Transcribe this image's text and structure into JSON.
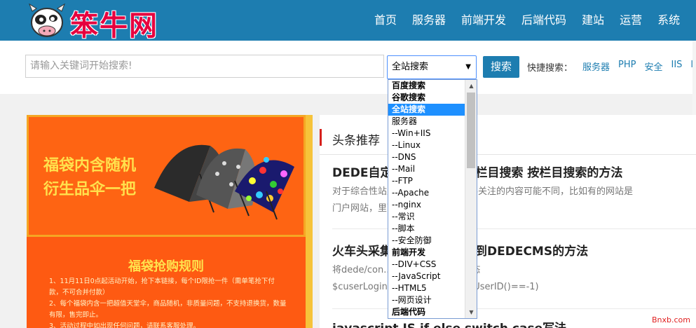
{
  "header": {
    "logo_text": "笨牛网",
    "nav": [
      "首页",
      "服务器",
      "前端开发",
      "后端代码",
      "建站",
      "运营",
      "系统"
    ]
  },
  "search": {
    "placeholder": "请输入关键词开始搜索!",
    "select_value": "全站搜索",
    "button_label": "搜索",
    "quick_label": "快捷搜索：",
    "quick_links": [
      "服务器",
      "PHP",
      "安全",
      "IIS",
      "li"
    ]
  },
  "dropdown": {
    "options": [
      "百度搜索",
      "谷歌搜索",
      "全站搜索",
      "服务器",
      "--Win+IIS",
      "--Linux",
      "--DNS",
      "--Mail",
      "--FTP",
      "--Apache",
      "--nginx",
      "--常识",
      "--脚本",
      "--安全防御",
      "前端开发",
      "--DIV+CSS",
      "--JavaScript",
      "--HTML5",
      "--网页设计",
      "后端代码"
    ],
    "selected_index": 2
  },
  "ad": {
    "headline_line1": "福袋内含随机",
    "headline_line2": "衍生品伞一把",
    "rules_title": "福袋抢购规则",
    "rules": [
      "1、11月11日0点起活动开始，抢下本链接，每个ID限抢一件（需单笔抢下付款，不可合并付款）",
      "2、每个福袋内含一把超值天堂伞，商品随机，非质量问题，不支持退换货，数量有限，售完即止。",
      "3、活动过程中如出现任何问题，请联系客服处理。"
    ]
  },
  "content": {
    "section_title": "头条推荐",
    "articles": [
      {
        "title": "DEDE自定义搜索页面指定栏目搜索 按栏目搜索的方法",
        "desc_line1": "对于综合性站点，栏目较多，而访客关注的内容可能不同，比如有的网站是",
        "desc_line2": "门户网站，里面的栏目各不同城..."
      },
      {
        "title": "火车头采集器发布数据发布到DEDECMS的方法",
        "desc_line1": "将dede/con...：//检验用户登录状态",
        "desc_line2": "$cuserLogin...($cuserLogin-getUserID()==-1)"
      },
      {
        "title": "javascript JS if else switch case写法",
        "desc_line1": "",
        "desc_line2": ""
      }
    ]
  },
  "watermark": "Bnxb.com"
}
